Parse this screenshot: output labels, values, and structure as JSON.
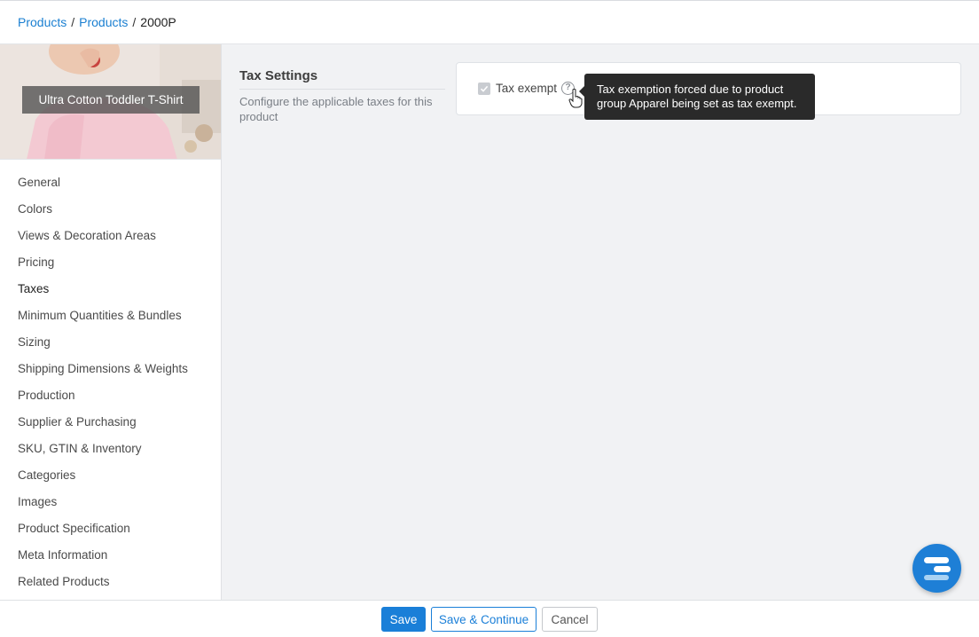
{
  "breadcrumb": {
    "items": [
      "Products",
      "Products"
    ],
    "separator": "/",
    "current": "2000P"
  },
  "sidebar": {
    "product_title": "Ultra Cotton Toddler T-Shirt",
    "items": [
      {
        "label": "General"
      },
      {
        "label": "Colors"
      },
      {
        "label": "Views & Decoration Areas"
      },
      {
        "label": "Pricing"
      },
      {
        "label": "Taxes",
        "active": true
      },
      {
        "label": "Minimum Quantities & Bundles"
      },
      {
        "label": "Sizing"
      },
      {
        "label": "Shipping Dimensions & Weights"
      },
      {
        "label": "Production"
      },
      {
        "label": "Supplier & Purchasing"
      },
      {
        "label": "SKU, GTIN & Inventory"
      },
      {
        "label": "Categories"
      },
      {
        "label": "Images"
      },
      {
        "label": "Product Specification"
      },
      {
        "label": "Meta Information"
      },
      {
        "label": "Related Products"
      }
    ]
  },
  "main": {
    "section_title": "Tax Settings",
    "section_description": "Configure the applicable taxes for this product",
    "tax_exempt": {
      "label": "Tax exempt",
      "checked": true,
      "disabled": true,
      "help_icon": "question-circle-icon",
      "tooltip": "Tax exemption forced due to product group Apparel being set as tax exempt."
    }
  },
  "footer": {
    "save_label": "Save",
    "save_continue_label": "Save & Continue",
    "cancel_label": "Cancel"
  },
  "chat_widget": {
    "icon": "chat-logo-icon"
  },
  "colors": {
    "accent": "#1a7fd8",
    "link": "#1a7fd1",
    "tooltip_bg": "#2a2a2a",
    "page_bg": "#f1f2f4"
  }
}
